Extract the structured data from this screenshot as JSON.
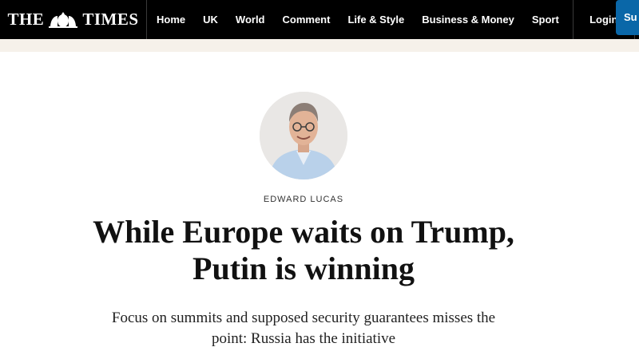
{
  "header": {
    "brand_left": "THE",
    "brand_right": "TIMES",
    "crest_icon": "royal-crest-icon",
    "nav": [
      "Home",
      "UK",
      "World",
      "Comment",
      "Life & Style",
      "Business & Money",
      "Sport"
    ],
    "login": "Login",
    "subscribe": "Su"
  },
  "article": {
    "author": "EDWARD LUCAS",
    "headline_line1": "While Europe waits on Trump,",
    "headline_line2": "Putin is winning",
    "standfirst_line1": "Focus on summits and supposed security guarantees misses the",
    "standfirst_line2": "point: Russia has the initiative"
  },
  "colors": {
    "topbar": "#000000",
    "subscribe": "#0a67a8",
    "strip": "#f6f1ea"
  }
}
